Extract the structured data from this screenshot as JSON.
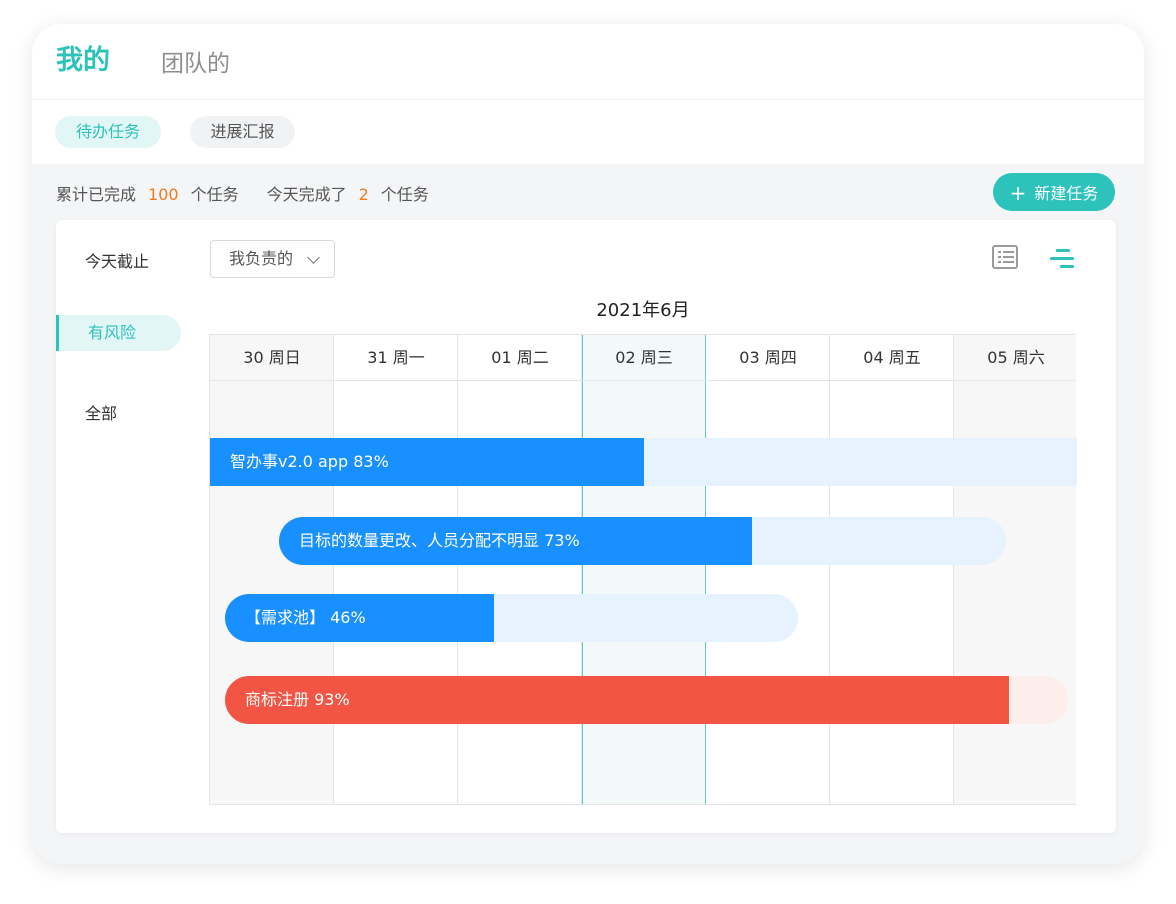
{
  "header": {
    "tab_mine": "我的",
    "tab_team": "团队的"
  },
  "subtabs": {
    "todo": "待办任务",
    "report": "进展汇报"
  },
  "stats": {
    "completed_prefix": "累计已完成",
    "completed_count": "100",
    "completed_suffix": "个任务",
    "today_prefix": "今天完成了",
    "today_count": "2",
    "today_suffix": "个任务"
  },
  "new_task_button": {
    "icon": "plus-icon",
    "label": "新建任务"
  },
  "sidebar": {
    "items": [
      {
        "label": "今天截止"
      },
      {
        "label": "有风险"
      },
      {
        "label": "全部"
      }
    ]
  },
  "filter": {
    "selected": "我负责的"
  },
  "view_icons": [
    "list-view-icon",
    "gantt-view-icon"
  ],
  "calendar": {
    "month": "2021年6月",
    "days": [
      "30 周日",
      "31 周一",
      "01 周二",
      "02 周三",
      "03 周四",
      "04 周五",
      "05 周六"
    ]
  },
  "tasks": [
    {
      "label": "智办事v2.0 app  83%",
      "progress": 0.5,
      "color": "#1890ff",
      "track": "#e6f3fe"
    },
    {
      "label": "目标的数量更改、人员分配不明显  73%",
      "progress": 0.65,
      "color": "#1890ff",
      "track": "#e6f3fe"
    },
    {
      "label": "【需求池】  46%",
      "progress": 0.47,
      "color": "#1890ff",
      "track": "#e6f3fe"
    },
    {
      "label": "商标注册  93%",
      "progress": 0.93,
      "color": "#f25543",
      "track": "#fdeeeb"
    }
  ],
  "colors": {
    "accent": "#2dc3bb",
    "highlight_number": "#f07a1c",
    "progress_blue": "#1890ff",
    "progress_red": "#f25543"
  }
}
